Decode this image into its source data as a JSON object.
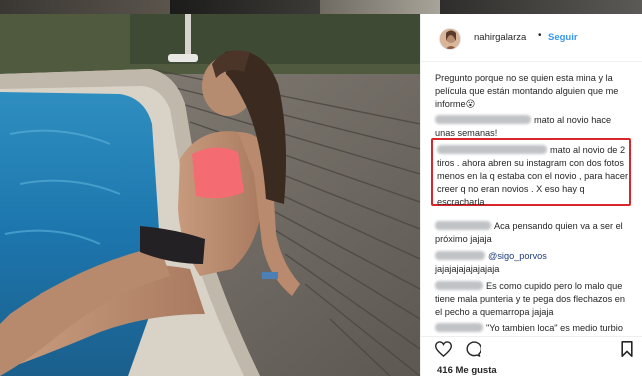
{
  "post": {
    "username": "nahirgalarza",
    "separator": "•",
    "follow_label": "Seguir",
    "likes_label": "416 Me gusta"
  },
  "comments": [
    {
      "text": "Pregunto porque no se quien esta mina y la película que están montando alguien que me informe😮"
    },
    {
      "text": "mato al novio hace unas semanas!"
    },
    {
      "text": "mato al novio de 2 tiros . ahora abren su instagram con dos fotos menos en la q estaba con el novio , para hacer creer q no eran novios . X eso hay q escracharla"
    },
    {
      "text": "Aca pensando quien va a ser el próximo jajaja"
    },
    {
      "mention": "@sigo_porvos",
      "text": "jajajajajajajajaja"
    },
    {
      "text": "Es como cupido pero lo malo que tiene mala punteria y te pega dos flechazos en el pecho a quemarropa jajaja"
    },
    {
      "text": "\"Yo tambien loca\" es medio turbio todo esto eran guerrilleras las"
    }
  ],
  "icons": [
    "heart-icon",
    "comment-icon",
    "share-icon",
    "bookmark-icon"
  ],
  "colors": {
    "accent": "#3897f0",
    "highlight": "#d9262b",
    "text": "#262626"
  }
}
